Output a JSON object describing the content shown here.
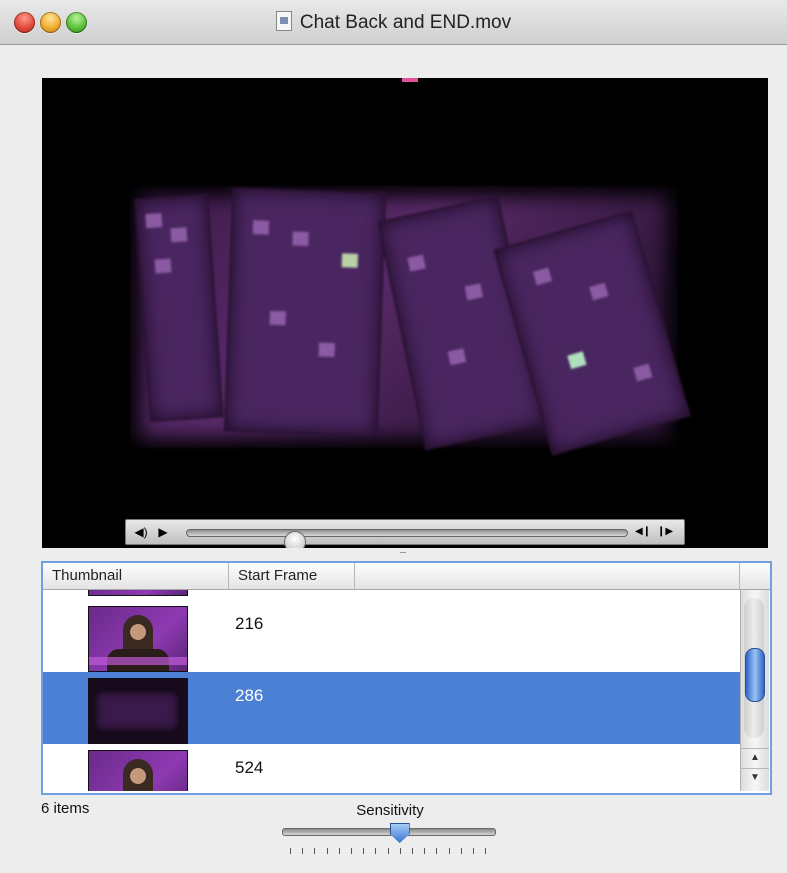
{
  "window": {
    "title": "Chat Back and END.mov"
  },
  "player": {
    "controls": {
      "volume_icon": "speaker-icon",
      "play_icon": "play-icon",
      "step_back_icon": "step-back-icon",
      "step_forward_icon": "step-forward-icon",
      "playhead_fraction": 0.23
    }
  },
  "table": {
    "columns": [
      "Thumbnail",
      "Start Frame"
    ],
    "rows": [
      {
        "start_frame": "216",
        "selected": false
      },
      {
        "start_frame": "286",
        "selected": true
      },
      {
        "start_frame": "524",
        "selected": false
      }
    ]
  },
  "footer": {
    "count": "6 items",
    "sensitivity_label": "Sensitivity",
    "sensitivity_fraction": 0.55
  },
  "colors": {
    "selection": "#4c80d4",
    "focus_ring": "#6fa1e0"
  }
}
